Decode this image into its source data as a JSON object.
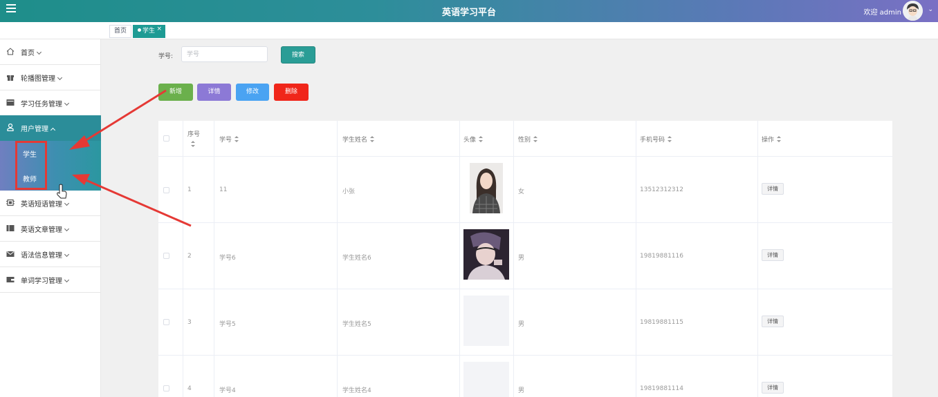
{
  "header": {
    "title": "英语学习平台",
    "welcome": "欢迎 admin"
  },
  "tabs": {
    "home": "首页",
    "active": "学生"
  },
  "sidebar": {
    "items": [
      {
        "label": "首页"
      },
      {
        "label": "轮播图管理"
      },
      {
        "label": "学习任务管理"
      },
      {
        "label": "用户管理"
      },
      {
        "label": "英语短语管理"
      },
      {
        "label": "英语文章管理"
      },
      {
        "label": "语法信息管理"
      },
      {
        "label": "单词学习管理"
      }
    ],
    "submenu": [
      "学生",
      "教师"
    ]
  },
  "search": {
    "label": "学号:",
    "placeholder": "学号",
    "button": "搜索"
  },
  "actions": {
    "add": "新增",
    "detail": "详情",
    "edit": "修改",
    "delete": "删除"
  },
  "table": {
    "columns": [
      "序号",
      "学号",
      "学生姓名",
      "头像",
      "性别",
      "手机号码",
      "操作"
    ],
    "rows": [
      {
        "index": "1",
        "id": "11",
        "name": "小张",
        "gender": "女",
        "phone": "13512312312",
        "action": "详情"
      },
      {
        "index": "2",
        "id": "学号6",
        "name": "学生姓名6",
        "gender": "男",
        "phone": "19819881116",
        "action": "详情"
      },
      {
        "index": "3",
        "id": "学号5",
        "name": "学生姓名5",
        "gender": "男",
        "phone": "19819881115",
        "action": "详情"
      },
      {
        "index": "4",
        "id": "学号4",
        "name": "学生姓名4",
        "gender": "男",
        "phone": "19819881114",
        "action": "详情"
      }
    ]
  },
  "colors": {
    "accent": "#1d9b94",
    "annotation": "#e53935"
  }
}
